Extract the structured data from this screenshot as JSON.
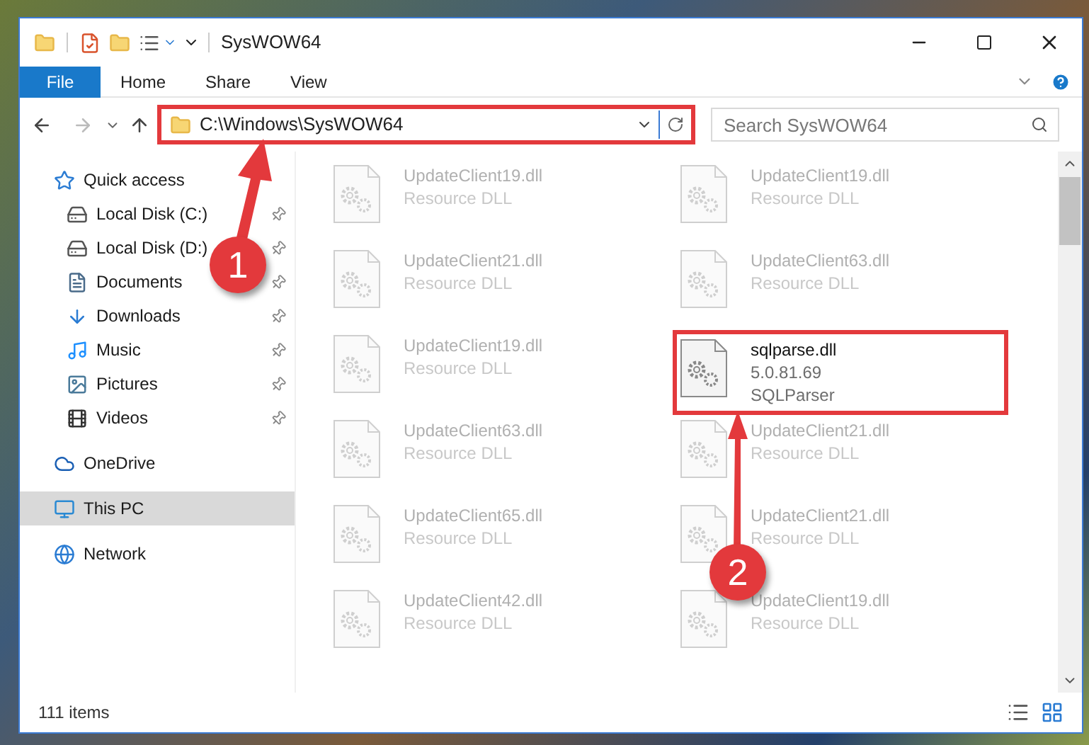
{
  "window": {
    "title": "SysWOW64"
  },
  "ribbon": {
    "tabs": [
      {
        "label": "File",
        "kind": "menu"
      },
      {
        "label": "Home",
        "kind": "tab"
      },
      {
        "label": "Share",
        "kind": "tab"
      },
      {
        "label": "View",
        "kind": "tab"
      }
    ]
  },
  "address_bar": {
    "path": "C:\\Windows\\SysWOW64",
    "highlighted": true,
    "search": {
      "placeholder": "Search SysWOW64"
    }
  },
  "sidebar": {
    "items": [
      {
        "label": "Quick access",
        "kind": "quick-access",
        "selected": false,
        "children": [
          {
            "label": "Local Disk (C:)",
            "kind": "system-drive",
            "pinned": true,
            "selected": false
          },
          {
            "label": "Local Disk (D:)",
            "kind": "drive",
            "pinned": true,
            "selected": false
          },
          {
            "label": "Documents",
            "kind": "documents",
            "pinned": true,
            "selected": false
          },
          {
            "label": "Downloads",
            "kind": "downloads",
            "pinned": true,
            "selected": false
          },
          {
            "label": "Music",
            "kind": "music",
            "pinned": true,
            "selected": false
          },
          {
            "label": "Pictures",
            "kind": "pictures",
            "pinned": true,
            "selected": false
          },
          {
            "label": "Videos",
            "kind": "videos",
            "pinned": true,
            "selected": false
          }
        ]
      },
      {
        "label": "OneDrive",
        "kind": "cloud",
        "selected": false
      },
      {
        "label": "This PC",
        "kind": "pc",
        "selected": true
      },
      {
        "label": "Network",
        "kind": "network",
        "selected": false
      }
    ]
  },
  "files": [
    {
      "name": "UpdateClient19.dll",
      "lines": [
        "Resource DLL"
      ],
      "highlighted": false
    },
    {
      "name": "UpdateClient19.dll",
      "lines": [
        "Resource DLL"
      ],
      "highlighted": false
    },
    {
      "name": "UpdateClient21.dll",
      "lines": [
        "Resource DLL"
      ],
      "highlighted": false
    },
    {
      "name": "UpdateClient63.dll",
      "lines": [
        "Resource DLL"
      ],
      "highlighted": false
    },
    {
      "name": "UpdateClient19.dll",
      "lines": [
        "Resource DLL"
      ],
      "highlighted": false
    },
    {
      "name": "sqlparse.dll",
      "lines": [
        "5.0.81.69",
        "SQLParser"
      ],
      "highlighted": true
    },
    {
      "name": "UpdateClient63.dll",
      "lines": [
        "Resource DLL"
      ],
      "highlighted": false
    },
    {
      "name": "UpdateClient21.dll",
      "lines": [
        "Resource DLL"
      ],
      "highlighted": false
    },
    {
      "name": "UpdateClient65.dll",
      "lines": [
        "Resource DLL"
      ],
      "highlighted": false
    },
    {
      "name": "UpdateClient21.dll",
      "lines": [
        "Resource DLL"
      ],
      "highlighted": false
    },
    {
      "name": "UpdateClient42.dll",
      "lines": [
        "Resource DLL"
      ],
      "highlighted": false
    },
    {
      "name": "UpdateClient19.dll",
      "lines": [
        "Resource DLL"
      ],
      "highlighted": false
    }
  ],
  "status_bar": {
    "count": "111 items"
  },
  "callouts": [
    {
      "number": "1"
    },
    {
      "number": "2"
    }
  ]
}
